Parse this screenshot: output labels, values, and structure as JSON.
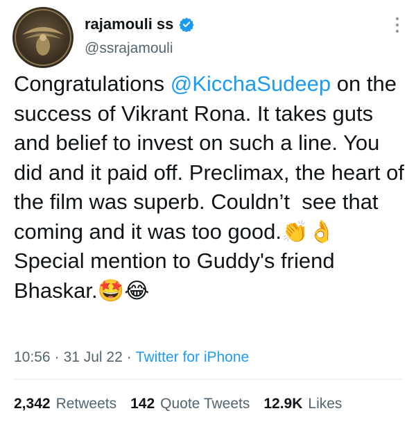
{
  "author": {
    "display_name": "rajamouli ss",
    "handle": "@ssrajamouli",
    "verified_icon": "verified-badge-icon",
    "accent_color": "#1d9bf0"
  },
  "tweet": {
    "segments": [
      "Congratulations ",
      "@KicchaSudeep",
      " on the success of Vikrant Rona. It takes guts and belief to invest on such a line. You did and it paid off. Preclimax, the heart of the film was superb. Couldn’t  see that coming and it was too good.",
      "👏👌",
      "\nSpecial mention to Guddy's friend Bhaskar.",
      "🤩😂"
    ]
  },
  "meta": {
    "time": "10:56",
    "separator": "·",
    "date": "31 Jul 22",
    "source": "Twitter for iPhone"
  },
  "stats": {
    "retweets_count": "2,342",
    "retweets_label": "Retweets",
    "quotes_count": "142",
    "quotes_label": "Quote Tweets",
    "likes_count": "12.9K",
    "likes_label": "Likes"
  }
}
